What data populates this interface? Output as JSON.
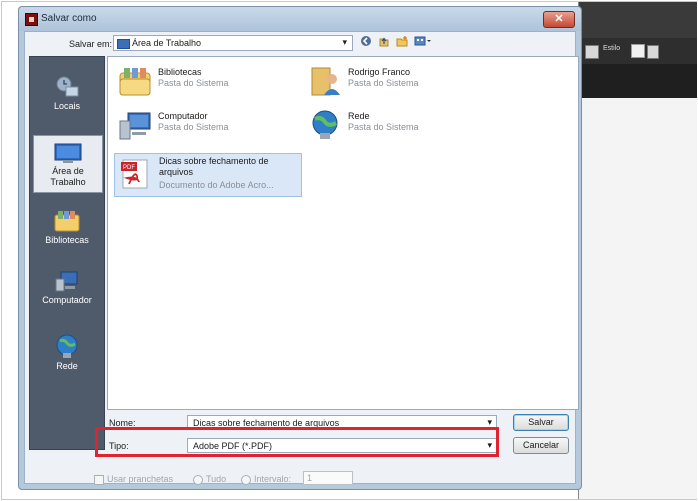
{
  "dialog": {
    "title": "Salvar como",
    "close_label": "✕",
    "save_in_label": "Salvar em:",
    "save_in_value": "Área de Trabalho"
  },
  "places": [
    {
      "label": "Locais",
      "icon": "recent-places-icon"
    },
    {
      "label": "Área de Trabalho",
      "icon": "desktop-icon",
      "selected": true
    },
    {
      "label": "Bibliotecas",
      "icon": "libraries-icon"
    },
    {
      "label": "Computador",
      "icon": "computer-icon"
    },
    {
      "label": "Rede",
      "icon": "network-icon"
    }
  ],
  "files": [
    {
      "name": "Bibliotecas",
      "sub": "Pasta do Sistema",
      "icon": "libraries-folder-icon"
    },
    {
      "name": "Rodrigo Franco",
      "sub": "Pasta do Sistema",
      "icon": "user-folder-icon"
    },
    {
      "name": "Computador",
      "sub": "Pasta do Sistema",
      "icon": "computer-icon"
    },
    {
      "name": "Rede",
      "sub": "Pasta do Sistema",
      "icon": "network-icon"
    },
    {
      "name": "Dicas sobre fechamento de arquivos",
      "sub": "Documento do Adobe Acro...",
      "icon": "pdf-file-icon",
      "selected": true
    }
  ],
  "form": {
    "name_label": "Nome:",
    "name_value": "Dicas sobre fechamento de arquivos",
    "type_label": "Tipo:",
    "type_value": "Adobe PDF (*.PDF)",
    "save_button": "Salvar",
    "cancel_button": "Cancelar",
    "use_boards_label": "Usar pranchetas",
    "all_label": "Tudo",
    "interval_label": "Intervalo:",
    "interval_value": "1"
  },
  "background_app": {
    "style_label": "Estilo"
  },
  "colors": {
    "highlight": "#e0232e",
    "accent": "#3d6fb7"
  }
}
